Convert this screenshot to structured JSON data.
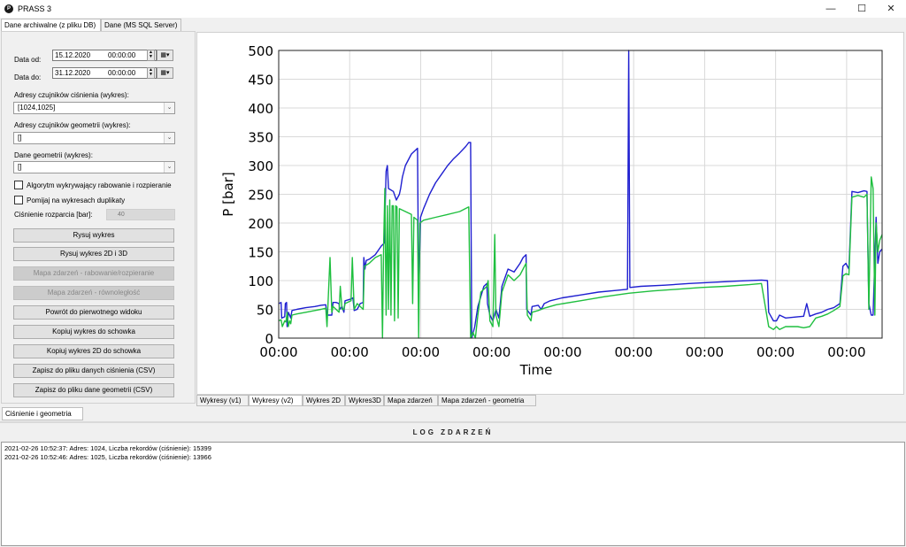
{
  "window": {
    "title": "PRASS 3",
    "icon": "app-logo-icon",
    "minimize": "—",
    "maximize": "☐",
    "close": "✕"
  },
  "top_tabs": [
    {
      "label": "Dane archiwalne (z pliku DB)",
      "active": true
    },
    {
      "label": "Dane (MS SQL Server)",
      "active": false
    }
  ],
  "form": {
    "date_from_label": "Data od:",
    "date_from": "15.12.2020",
    "time_from": "00:00:00",
    "date_to_label": "Data do:",
    "date_to": "31.12.2020",
    "time_to": "00:00:00",
    "pressure_addr_label": "Adresy czujników ciśnienia (wykres):",
    "pressure_addr_value": "[1024,1025]",
    "geom_addr_label": "Adresy czujników geometrii (wykres):",
    "geom_addr_value": "[]",
    "geom_data_label": "Dane geometrii (wykres):",
    "geom_data_value": "[]",
    "algo_checkbox_label": "Algorytm wykrywający rabowanie i rozpieranie",
    "skip_dup_label": "Pomijaj na wykresach duplikaty",
    "pressure_label": "Ciśnienie rozparcia [bar]:",
    "pressure_value": "40"
  },
  "buttons": [
    {
      "label": "Rysuj wykres",
      "enabled": true
    },
    {
      "label": "Rysuj wykres 2D i 3D",
      "enabled": true
    },
    {
      "label": "Mapa zdarzeń - rabowanie/rozpieranie",
      "enabled": false
    },
    {
      "label": "Mapa zdarzeń - równoległość",
      "enabled": false
    },
    {
      "label": "Powrót do pierwotnego widoku",
      "enabled": true
    },
    {
      "label": "Kopiuj wykres do schowka",
      "enabled": true
    },
    {
      "label": "Kopiuj wykres 2D do schowka",
      "enabled": true
    },
    {
      "label": "Zapisz do pliku danych ciśnienia (CSV)",
      "enabled": true
    },
    {
      "label": "Zapisz do pliku dane geometrii (CSV)",
      "enabled": true
    }
  ],
  "chart_tabs": [
    {
      "label": "Wykresy (v1)",
      "active": false
    },
    {
      "label": "Wykresy (v2)",
      "active": true
    },
    {
      "label": "Wykres 2D",
      "active": false
    },
    {
      "label": "Wykres3D",
      "active": false
    },
    {
      "label": "Mapa zdarzeń",
      "active": false
    },
    {
      "label": "Mapa zdarzeń - geometria",
      "active": false
    }
  ],
  "left_bottom_tab": "Ciśnienie i geometria",
  "log": {
    "title": "LOG ZDARZEŃ",
    "lines": [
      "2021-02-26 10:52:37: Adres: 1024, Liczba rekordów (ciśnienie): 15399",
      "2021-02-26 10:52:46: Adres: 1025, Liczba rekordów (ciśnienie): 13966"
    ]
  },
  "chart_data": {
    "type": "line",
    "xlabel": "Time",
    "ylabel": "P [bar]",
    "ylim": [
      0,
      500
    ],
    "yticks": [
      0,
      50,
      100,
      150,
      200,
      250,
      300,
      350,
      400,
      450,
      500
    ],
    "xlim": [
      0,
      1
    ],
    "xticks": [
      0,
      0.1176,
      0.2353,
      0.3529,
      0.4706,
      0.5882,
      0.7059,
      0.8235,
      0.9412
    ],
    "xtick_labels": [
      "00:00",
      "00:00",
      "00:00",
      "00:00",
      "00:00",
      "00:00",
      "00:00",
      "00:00",
      "00:00"
    ],
    "grid": true,
    "series": [
      {
        "color": "#1f1fd0",
        "points": [
          [
            0.0,
            60
          ],
          [
            0.004,
            62
          ],
          [
            0.005,
            35
          ],
          [
            0.01,
            37
          ],
          [
            0.011,
            60
          ],
          [
            0.013,
            62
          ],
          [
            0.014,
            20
          ],
          [
            0.016,
            45
          ],
          [
            0.018,
            40
          ],
          [
            0.02,
            35
          ],
          [
            0.022,
            48
          ],
          [
            0.03,
            50
          ],
          [
            0.045,
            53
          ],
          [
            0.06,
            55
          ],
          [
            0.07,
            57
          ],
          [
            0.078,
            58
          ],
          [
            0.08,
            40
          ],
          [
            0.088,
            40
          ],
          [
            0.09,
            62
          ],
          [
            0.095,
            62
          ],
          [
            0.1,
            60
          ],
          [
            0.101,
            50
          ],
          [
            0.105,
            55
          ],
          [
            0.108,
            45
          ],
          [
            0.11,
            65
          ],
          [
            0.12,
            68
          ],
          [
            0.123,
            70
          ],
          [
            0.125,
            48
          ],
          [
            0.13,
            50
          ],
          [
            0.135,
            60
          ],
          [
            0.14,
            62
          ],
          [
            0.141,
            140
          ],
          [
            0.143,
            120
          ],
          [
            0.145,
            135
          ],
          [
            0.15,
            137
          ],
          [
            0.16,
            145
          ],
          [
            0.17,
            160
          ],
          [
            0.175,
            165
          ],
          [
            0.178,
            290
          ],
          [
            0.18,
            300
          ],
          [
            0.182,
            260
          ],
          [
            0.19,
            255
          ],
          [
            0.195,
            240
          ],
          [
            0.2,
            250
          ],
          [
            0.202,
            260
          ],
          [
            0.205,
            280
          ],
          [
            0.21,
            300
          ],
          [
            0.22,
            320
          ],
          [
            0.23,
            330
          ],
          [
            0.232,
            70
          ],
          [
            0.235,
            210
          ],
          [
            0.24,
            225
          ],
          [
            0.25,
            250
          ],
          [
            0.26,
            270
          ],
          [
            0.27,
            285
          ],
          [
            0.28,
            300
          ],
          [
            0.29,
            312
          ],
          [
            0.3,
            322
          ],
          [
            0.31,
            333
          ],
          [
            0.315,
            340
          ],
          [
            0.318,
            340
          ],
          [
            0.32,
            0
          ],
          [
            0.325,
            20
          ],
          [
            0.33,
            55
          ],
          [
            0.34,
            90
          ],
          [
            0.345,
            95
          ],
          [
            0.346,
            60
          ],
          [
            0.35,
            40
          ],
          [
            0.355,
            30
          ],
          [
            0.36,
            50
          ],
          [
            0.365,
            35
          ],
          [
            0.37,
            90
          ],
          [
            0.38,
            120
          ],
          [
            0.39,
            115
          ],
          [
            0.4,
            130
          ],
          [
            0.405,
            140
          ],
          [
            0.41,
            145
          ],
          [
            0.411,
            50
          ],
          [
            0.418,
            40
          ],
          [
            0.42,
            55
          ],
          [
            0.43,
            57
          ],
          [
            0.435,
            50
          ],
          [
            0.44,
            60
          ],
          [
            0.45,
            65
          ],
          [
            0.47,
            70
          ],
          [
            0.5,
            75
          ],
          [
            0.53,
            80
          ],
          [
            0.56,
            83
          ],
          [
            0.578,
            85
          ],
          [
            0.58,
            500
          ],
          [
            0.582,
            88
          ],
          [
            0.6,
            90
          ],
          [
            0.64,
            92
          ],
          [
            0.68,
            95
          ],
          [
            0.72,
            97
          ],
          [
            0.76,
            99
          ],
          [
            0.8,
            101
          ],
          [
            0.81,
            100
          ],
          [
            0.812,
            45
          ],
          [
            0.82,
            30
          ],
          [
            0.825,
            30
          ],
          [
            0.83,
            40
          ],
          [
            0.84,
            35
          ],
          [
            0.86,
            37
          ],
          [
            0.87,
            38
          ],
          [
            0.875,
            60
          ],
          [
            0.88,
            38
          ],
          [
            0.89,
            42
          ],
          [
            0.9,
            45
          ],
          [
            0.91,
            50
          ],
          [
            0.92,
            53
          ],
          [
            0.93,
            60
          ],
          [
            0.935,
            125
          ],
          [
            0.94,
            130
          ],
          [
            0.945,
            120
          ],
          [
            0.95,
            255
          ],
          [
            0.96,
            253
          ],
          [
            0.97,
            256
          ],
          [
            0.975,
            255
          ],
          [
            0.978,
            60
          ],
          [
            0.982,
            40
          ],
          [
            0.985,
            40
          ],
          [
            0.99,
            210
          ],
          [
            0.993,
            130
          ],
          [
            0.996,
            150
          ],
          [
            1.0,
            155
          ]
        ]
      },
      {
        "color": "#1fbf3f",
        "points": [
          [
            0.0,
            30
          ],
          [
            0.004,
            32
          ],
          [
            0.006,
            20
          ],
          [
            0.01,
            30
          ],
          [
            0.012,
            28
          ],
          [
            0.014,
            45
          ],
          [
            0.016,
            20
          ],
          [
            0.018,
            30
          ],
          [
            0.02,
            25
          ],
          [
            0.022,
            40
          ],
          [
            0.03,
            42
          ],
          [
            0.045,
            45
          ],
          [
            0.06,
            48
          ],
          [
            0.07,
            50
          ],
          [
            0.078,
            52
          ],
          [
            0.08,
            20
          ],
          [
            0.085,
            140
          ],
          [
            0.088,
            45
          ],
          [
            0.09,
            55
          ],
          [
            0.095,
            50
          ],
          [
            0.1,
            45
          ],
          [
            0.102,
            90
          ],
          [
            0.105,
            50
          ],
          [
            0.108,
            50
          ],
          [
            0.11,
            60
          ],
          [
            0.12,
            65
          ],
          [
            0.122,
            140
          ],
          [
            0.125,
            50
          ],
          [
            0.13,
            60
          ],
          [
            0.135,
            55
          ],
          [
            0.14,
            50
          ],
          [
            0.142,
            125
          ],
          [
            0.15,
            130
          ],
          [
            0.16,
            140
          ],
          [
            0.17,
            145
          ],
          [
            0.172,
            0
          ],
          [
            0.174,
            170
          ],
          [
            0.176,
            260
          ],
          [
            0.178,
            40
          ],
          [
            0.18,
            230
          ],
          [
            0.182,
            50
          ],
          [
            0.184,
            240
          ],
          [
            0.186,
            40
          ],
          [
            0.188,
            230
          ],
          [
            0.19,
            230
          ],
          [
            0.192,
            30
          ],
          [
            0.194,
            230
          ],
          [
            0.196,
            228
          ],
          [
            0.198,
            35
          ],
          [
            0.2,
            225
          ],
          [
            0.21,
            220
          ],
          [
            0.22,
            215
          ],
          [
            0.222,
            60
          ],
          [
            0.224,
            210
          ],
          [
            0.23,
            205
          ],
          [
            0.232,
            0
          ],
          [
            0.234,
            200
          ],
          [
            0.24,
            205
          ],
          [
            0.26,
            210
          ],
          [
            0.28,
            215
          ],
          [
            0.3,
            220
          ],
          [
            0.315,
            228
          ],
          [
            0.318,
            0
          ],
          [
            0.322,
            10
          ],
          [
            0.326,
            0
          ],
          [
            0.33,
            40
          ],
          [
            0.335,
            80
          ],
          [
            0.34,
            85
          ],
          [
            0.345,
            90
          ],
          [
            0.347,
            100
          ],
          [
            0.35,
            30
          ],
          [
            0.355,
            20
          ],
          [
            0.358,
            180
          ],
          [
            0.36,
            40
          ],
          [
            0.365,
            20
          ],
          [
            0.37,
            80
          ],
          [
            0.38,
            110
          ],
          [
            0.39,
            100
          ],
          [
            0.4,
            110
          ],
          [
            0.405,
            120
          ],
          [
            0.41,
            130
          ],
          [
            0.412,
            40
          ],
          [
            0.418,
            30
          ],
          [
            0.42,
            45
          ],
          [
            0.43,
            48
          ],
          [
            0.44,
            52
          ],
          [
            0.46,
            58
          ],
          [
            0.5,
            65
          ],
          [
            0.54,
            72
          ],
          [
            0.58,
            78
          ],
          [
            0.62,
            82
          ],
          [
            0.66,
            85
          ],
          [
            0.7,
            88
          ],
          [
            0.74,
            90
          ],
          [
            0.78,
            93
          ],
          [
            0.8,
            95
          ],
          [
            0.812,
            20
          ],
          [
            0.82,
            15
          ],
          [
            0.825,
            20
          ],
          [
            0.83,
            15
          ],
          [
            0.84,
            20
          ],
          [
            0.86,
            20
          ],
          [
            0.87,
            18
          ],
          [
            0.88,
            20
          ],
          [
            0.89,
            35
          ],
          [
            0.9,
            38
          ],
          [
            0.91,
            42
          ],
          [
            0.92,
            48
          ],
          [
            0.93,
            55
          ],
          [
            0.935,
            108
          ],
          [
            0.94,
            112
          ],
          [
            0.945,
            110
          ],
          [
            0.95,
            245
          ],
          [
            0.96,
            248
          ],
          [
            0.97,
            245
          ],
          [
            0.975,
            250
          ],
          [
            0.978,
            50
          ],
          [
            0.982,
            280
          ],
          [
            0.985,
            260
          ],
          [
            0.988,
            40
          ],
          [
            0.99,
            200
          ],
          [
            0.993,
            150
          ],
          [
            0.996,
            170
          ],
          [
            1.0,
            180
          ]
        ]
      }
    ]
  }
}
